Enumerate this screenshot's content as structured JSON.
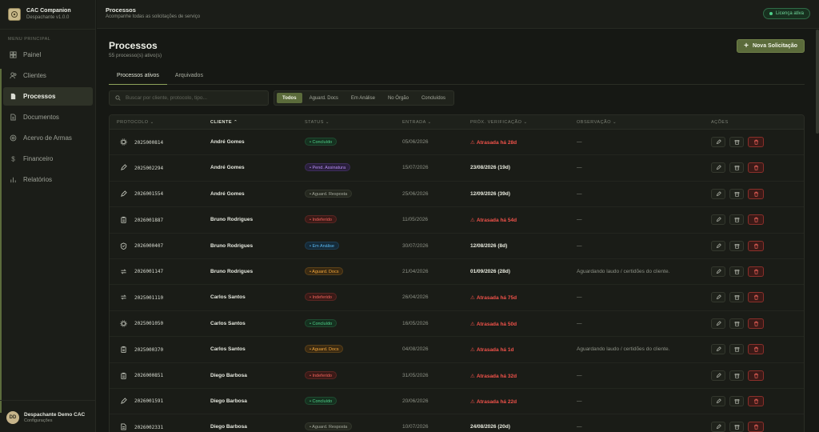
{
  "brand": {
    "name": "CAC Companion",
    "version": "Despachante v1.0.0"
  },
  "sidebar": {
    "menu_title": "MENU PRINCIPAL",
    "items": [
      {
        "label": "Painel",
        "icon": "grid-icon",
        "active": false
      },
      {
        "label": "Clientes",
        "icon": "users-icon",
        "active": false
      },
      {
        "label": "Processos",
        "icon": "file-icon",
        "active": true
      },
      {
        "label": "Documentos",
        "icon": "document-icon",
        "active": false
      },
      {
        "label": "Acervo de Armas",
        "icon": "target-icon",
        "active": false
      },
      {
        "label": "Financeiro",
        "icon": "dollar-icon",
        "active": false
      },
      {
        "label": "Relatórios",
        "icon": "chart-icon",
        "active": false
      }
    ],
    "user": {
      "initials": "DD",
      "name": "Despachante Demo CAC",
      "sub": "Configurações"
    }
  },
  "topbar": {
    "title": "Processos",
    "subtitle": "Acompanhe todas as solicitações de serviço",
    "license": "Licença ativa"
  },
  "main": {
    "title": "Processos",
    "subtitle": "55 processo(s) ativo(s)",
    "new_button": "Nova Solicitação",
    "tabs": [
      {
        "label": "Processos ativos",
        "active": true
      },
      {
        "label": "Arquivados",
        "active": false
      }
    ],
    "search_placeholder": "Buscar por cliente, protocolo, tipo...",
    "filters": [
      {
        "label": "Todos",
        "active": true
      },
      {
        "label": "Aguard. Docs",
        "active": false
      },
      {
        "label": "Em Análise",
        "active": false
      },
      {
        "label": "No Órgão",
        "active": false
      },
      {
        "label": "Concluídos",
        "active": false
      }
    ]
  },
  "table": {
    "headers": {
      "protocolo": "PROTOCOLO",
      "cliente": "CLIENTE",
      "status": "STATUS",
      "entrada": "ENTRADA",
      "prox": "PRÓX. VERIFICAÇÃO",
      "obs": "OBSERVAÇÃO",
      "acoes": "AÇÕES"
    },
    "status_colors": {
      "Concluído": {
        "fg": "#4fd08a",
        "bg": "#15301f",
        "bd": "#1f4a30"
      },
      "Pend. Assinatura": {
        "fg": "#b48cf0",
        "bg": "#2a1f3c",
        "bd": "#3d2d5a"
      },
      "Aguard. Resposta": {
        "fg": "#a7ab9f",
        "bg": "#25281f",
        "bd": "#33372d"
      },
      "Indeferido": {
        "fg": "#f0625a",
        "bg": "#3a1a17",
        "bd": "#5a2622"
      },
      "Em Análise": {
        "fg": "#5ab8f0",
        "bg": "#152a38",
        "bd": "#1f3d52"
      },
      "Aguard. Docs": {
        "fg": "#f0a53a",
        "bg": "#3a2a12",
        "bd": "#5a4019"
      }
    },
    "rows": [
      {
        "icon": "gear-icon",
        "protocolo": "2025000814",
        "cliente": "André Gomes",
        "status": "Concluído",
        "entrada": "05/06/2026",
        "prox": "Atrasada há 28d",
        "late": true,
        "obs": "—"
      },
      {
        "icon": "pencil-icon",
        "protocolo": "2025002294",
        "cliente": "André Gomes",
        "status": "Pend. Assinatura",
        "entrada": "15/07/2026",
        "prox": "23/08/2026 (19d)",
        "late": false,
        "obs": "—"
      },
      {
        "icon": "pencil-icon",
        "protocolo": "2026001554",
        "cliente": "André Gomes",
        "status": "Aguard. Resposta",
        "entrada": "25/06/2026",
        "prox": "12/09/2026 (39d)",
        "late": false,
        "obs": "—"
      },
      {
        "icon": "clipboard-icon",
        "protocolo": "2026001887",
        "cliente": "Bruno Rodrigues",
        "status": "Indeferido",
        "entrada": "11/05/2026",
        "prox": "Atrasada há 54d",
        "late": true,
        "obs": "—"
      },
      {
        "icon": "shield-icon",
        "protocolo": "2026000407",
        "cliente": "Bruno Rodrigues",
        "status": "Em Análise",
        "entrada": "30/07/2026",
        "prox": "12/08/2026 (8d)",
        "late": false,
        "obs": "—"
      },
      {
        "icon": "transfer-icon",
        "protocolo": "2026001147",
        "cliente": "Bruno Rodrigues",
        "status": "Aguard. Docs",
        "entrada": "21/04/2026",
        "prox": "01/09/2026 (28d)",
        "late": false,
        "obs": "Aguardando laudo / certidões do cliente."
      },
      {
        "icon": "transfer-icon",
        "protocolo": "2025001110",
        "cliente": "Carlos Santos",
        "status": "Indeferido",
        "entrada": "26/04/2026",
        "prox": "Atrasada há 75d",
        "late": true,
        "obs": "—"
      },
      {
        "icon": "gear-icon",
        "protocolo": "2025001050",
        "cliente": "Carlos Santos",
        "status": "Concluído",
        "entrada": "16/05/2026",
        "prox": "Atrasada há 50d",
        "late": true,
        "obs": "—"
      },
      {
        "icon": "clipboard-icon",
        "protocolo": "2025000370",
        "cliente": "Carlos Santos",
        "status": "Aguard. Docs",
        "entrada": "04/08/2026",
        "prox": "Atrasada há 1d",
        "late": true,
        "obs": "Aguardando laudo / certidões do cliente."
      },
      {
        "icon": "clipboard-icon",
        "protocolo": "2026000851",
        "cliente": "Diego Barbosa",
        "status": "Indeferido",
        "entrada": "31/05/2026",
        "prox": "Atrasada há 32d",
        "late": true,
        "obs": "—"
      },
      {
        "icon": "pencil-icon",
        "protocolo": "2026001591",
        "cliente": "Diego Barbosa",
        "status": "Concluído",
        "entrada": "20/06/2026",
        "prox": "Atrasada há 22d",
        "late": true,
        "obs": "—"
      },
      {
        "icon": "document-icon",
        "protocolo": "2026002331",
        "cliente": "Diego Barbosa",
        "status": "Aguard. Resposta",
        "entrada": "10/07/2026",
        "prox": "24/08/2026 (20d)",
        "late": false,
        "obs": "—"
      }
    ]
  }
}
